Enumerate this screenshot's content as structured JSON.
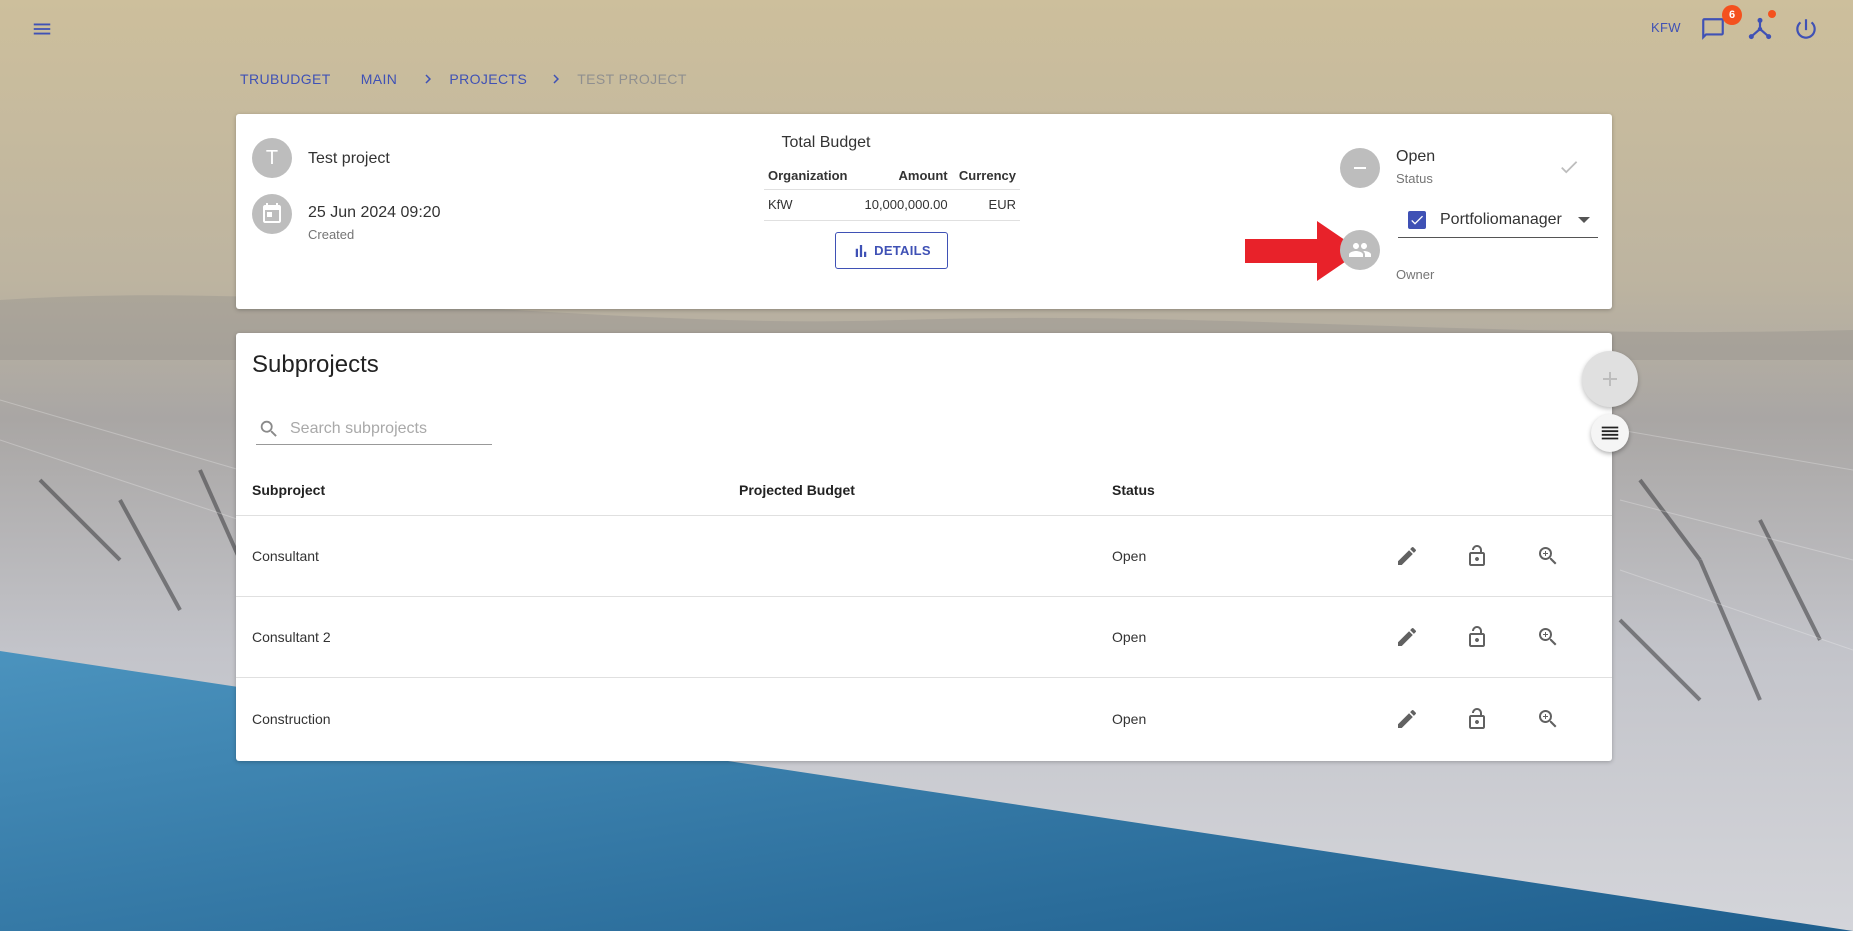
{
  "topbar": {
    "menu_icon": "menu-icon",
    "org_label": "KFW",
    "notifications_count": "6",
    "icons": [
      "chat-icon",
      "network-icon",
      "power-icon"
    ]
  },
  "breadcrumb": {
    "items": [
      "TRUBUDGET",
      "MAIN",
      "PROJECTS",
      "TEST PROJECT"
    ],
    "separator": "›"
  },
  "project": {
    "avatar_letter": "T",
    "name": "Test project",
    "created_date": "25 Jun 2024 09:20",
    "created_label": "Created",
    "status_value": "Open",
    "status_label": "Status",
    "owner_value": "Portfoliomanager",
    "owner_label": "Owner"
  },
  "budget": {
    "title": "Total Budget",
    "headers": [
      "Organization",
      "Amount",
      "Currency"
    ],
    "rows": [
      {
        "organization": "KfW",
        "amount": "10,000,000.00",
        "currency": "EUR"
      }
    ],
    "details_label": "DETAILS"
  },
  "subprojects": {
    "title": "Subprojects",
    "search_placeholder": "Search subprojects",
    "headers": [
      "Subproject",
      "Projected Budget",
      "Status"
    ],
    "rows": [
      {
        "name": "Consultant",
        "budget": "",
        "status": "Open"
      },
      {
        "name": "Consultant 2",
        "budget": "",
        "status": "Open"
      },
      {
        "name": "Construction",
        "budget": "",
        "status": "Open"
      }
    ]
  },
  "colors": {
    "primary": "#3f51b5",
    "badge": "#f4511e",
    "annotation_arrow": "#e8222a",
    "avatar_grey": "#bdbdbd"
  }
}
